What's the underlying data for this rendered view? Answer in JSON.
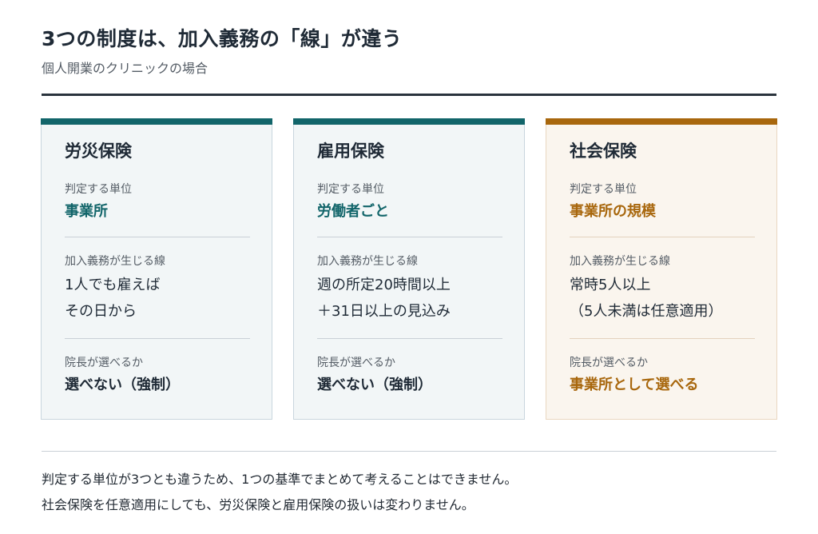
{
  "header": {
    "title": "3つの制度は、加入義務の「線」が違う",
    "subtitle": "個人開業のクリニックの場合"
  },
  "cards": [
    {
      "title": "労災保険",
      "unit_label": "判定する単位",
      "unit_value": "事業所",
      "line_label": "加入義務が生じる線",
      "line_value_1": "1人でも雇えば",
      "line_value_2": "その日から",
      "choice_label": "院長が選べるか",
      "choice_value": "選べない（強制）"
    },
    {
      "title": "雇用保険",
      "unit_label": "判定する単位",
      "unit_value": "労働者ごと",
      "line_label": "加入義務が生じる線",
      "line_value_1": "週の所定20時間以上",
      "line_value_2": "＋31日以上の見込み",
      "choice_label": "院長が選べるか",
      "choice_value": "選べない（強制）"
    },
    {
      "title": "社会保険",
      "unit_label": "判定する単位",
      "unit_value": "事業所の規模",
      "line_label": "加入義務が生じる線",
      "line_value_1": "常時5人以上",
      "line_value_2": "（5人未満は任意適用）",
      "choice_label": "院長が選べるか",
      "choice_value": "事業所として選べる"
    }
  ],
  "notes": [
    "判定する単位が3つとも違うため、1つの基準でまとめて考えることはできません。",
    "社会保険を任意適用にしても、労災保険と雇用保険の扱いは変わりません。"
  ],
  "colors": {
    "teal_accent": "#12656a",
    "amber_accent": "#a8670d",
    "card_bg": "#f2f6f7",
    "card_bg_social": "#faf5ee"
  }
}
